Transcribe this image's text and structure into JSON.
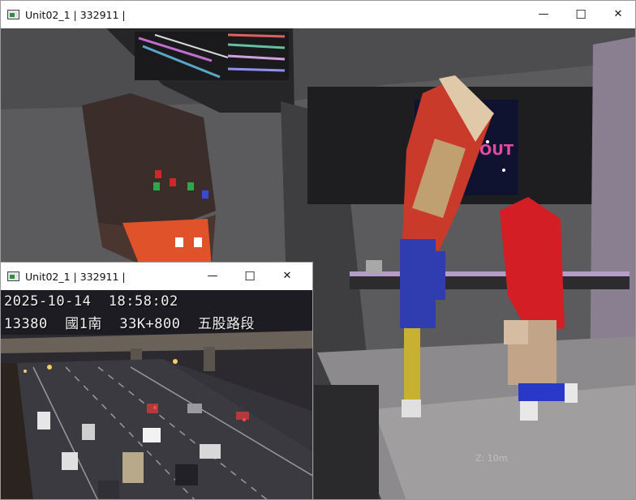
{
  "main_window": {
    "title": "Unit02_1 | 332911 |",
    "controls": {
      "minimize": "—",
      "maximize": "☐",
      "close": "✕"
    },
    "scene": {
      "poster_text": "OUT",
      "hud_readout": "Z: 10m"
    }
  },
  "camera_window": {
    "title": "Unit02_1 | 332911 |",
    "controls": {
      "minimize": "—",
      "maximize": "☐",
      "close": "✕"
    },
    "feed": {
      "timestamp": "2025-10-14  18:58:02",
      "location": "13380  國1南  33K+800  五股路段"
    }
  }
}
